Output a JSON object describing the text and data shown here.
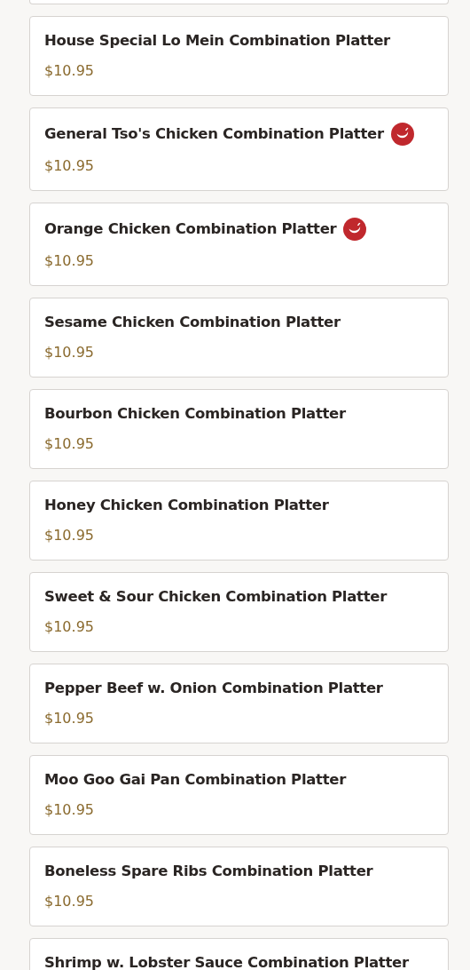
{
  "menu_items": [
    {
      "name": "House Special Lo Mein Combination Platter",
      "price": "$10.95",
      "spicy": false
    },
    {
      "name": "General Tso's Chicken Combination Platter",
      "price": "$10.95",
      "spicy": true
    },
    {
      "name": "Orange Chicken Combination Platter",
      "price": "$10.95",
      "spicy": true
    },
    {
      "name": "Sesame Chicken Combination Platter",
      "price": "$10.95",
      "spicy": false
    },
    {
      "name": "Bourbon Chicken Combination Platter",
      "price": "$10.95",
      "spicy": false
    },
    {
      "name": "Honey Chicken Combination Platter",
      "price": "$10.95",
      "spicy": false
    },
    {
      "name": "Sweet & Sour Chicken Combination Platter",
      "price": "$10.95",
      "spicy": false
    },
    {
      "name": "Pepper Beef w. Onion Combination Platter",
      "price": "$10.95",
      "spicy": false
    },
    {
      "name": "Moo Goo Gai Pan Combination Platter",
      "price": "$10.95",
      "spicy": false
    },
    {
      "name": "Boneless Spare Ribs Combination Platter",
      "price": "$10.95",
      "spicy": false
    },
    {
      "name": "Shrimp w. Lobster Sauce Combination Platter",
      "spicy": false
    }
  ]
}
